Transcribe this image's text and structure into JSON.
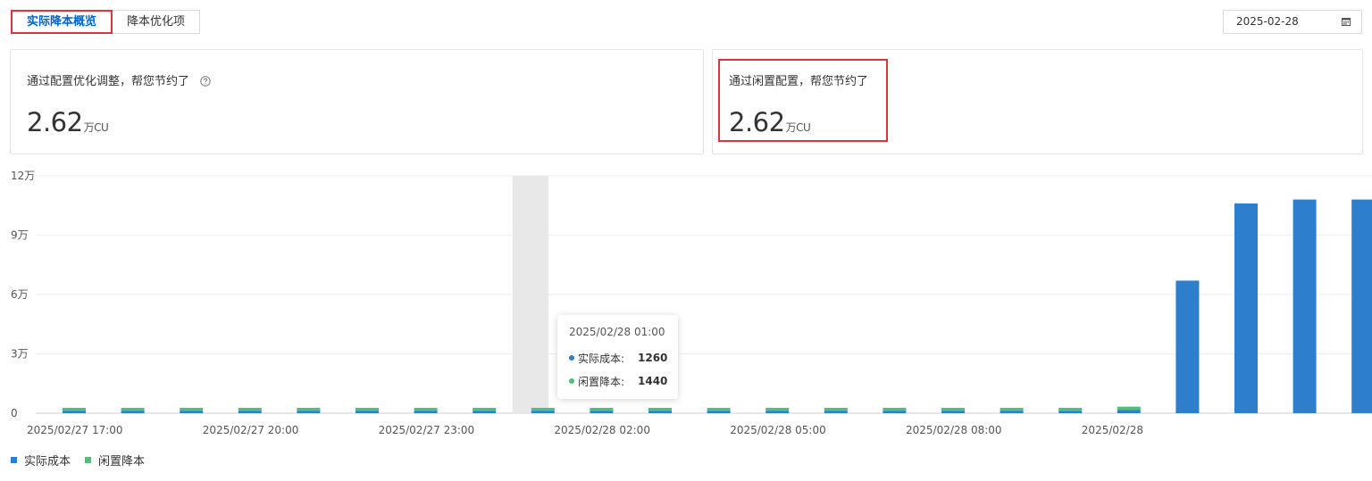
{
  "tabs": [
    {
      "label": "实际降本概览",
      "active": true
    },
    {
      "label": "降本优化项",
      "active": false
    }
  ],
  "date_picker": {
    "value": "2025-02-28",
    "icon": "calendar-icon"
  },
  "cards": [
    {
      "title": "通过配置优化调整，帮您节约了",
      "value": "2.62",
      "unit": "万CU",
      "has_help": true
    },
    {
      "title": "通过闲置配置，帮您节约了",
      "value": "2.62",
      "unit": "万CU",
      "has_help": false
    }
  ],
  "colors": {
    "actual": "#2d7fce",
    "idle": "#4cc07c",
    "accent": "#0064c8",
    "highlight": "#d9363e"
  },
  "chart_data": {
    "type": "bar",
    "stacked": true,
    "y_ticks": [
      "0",
      "3万",
      "6万",
      "9万",
      "12万"
    ],
    "ylim": [
      0,
      120000
    ],
    "grid": true,
    "legend_position": "bottom-left",
    "x_labels": [
      "2025/02/27 17:00",
      "2025/02/27 20:00",
      "2025/02/27 23:00",
      "2025/02/28 02:00",
      "2025/02/28 05:00",
      "2025/02/28 08:00",
      "2025/02/28"
    ],
    "categories": [
      "2025/02/27 17:00",
      "2025/02/27 18:00",
      "2025/02/27 19:00",
      "2025/02/27 20:00",
      "2025/02/27 21:00",
      "2025/02/27 22:00",
      "2025/02/27 23:00",
      "2025/02/28 00:00",
      "2025/02/28 01:00",
      "2025/02/28 02:00",
      "2025/02/28 03:00",
      "2025/02/28 04:00",
      "2025/02/28 05:00",
      "2025/02/28 06:00",
      "2025/02/28 07:00",
      "2025/02/28 08:00",
      "2025/02/28 09:00",
      "2025/02/28 10:00",
      "2025/02/28 11:00",
      "2025/02/28 12:00",
      "2025/02/28 13:00",
      "2025/02/28 14:00",
      "2025/02/28 15:00"
    ],
    "series": [
      {
        "name": "实际成本",
        "values": [
          1260,
          1260,
          1260,
          1260,
          1260,
          1260,
          1260,
          1260,
          1260,
          1260,
          1260,
          1260,
          1260,
          1260,
          1260,
          1260,
          1260,
          1260,
          1600,
          67000,
          106000,
          108000,
          108000
        ]
      },
      {
        "name": "闲置降本",
        "values": [
          1440,
          1440,
          1440,
          1440,
          1440,
          1440,
          1440,
          1440,
          1440,
          1440,
          1440,
          1440,
          1440,
          1440,
          1440,
          1440,
          1440,
          1440,
          1700,
          0,
          0,
          0,
          0
        ]
      }
    ],
    "highlighted_index": 8
  },
  "tooltip": {
    "time": "2025/02/28 01:00",
    "rows": [
      {
        "label": "实际成本:",
        "value": "1260"
      },
      {
        "label": "闲置降本:",
        "value": "1440"
      }
    ]
  },
  "legend": [
    {
      "label": "实际成本"
    },
    {
      "label": "闲置降本"
    }
  ]
}
